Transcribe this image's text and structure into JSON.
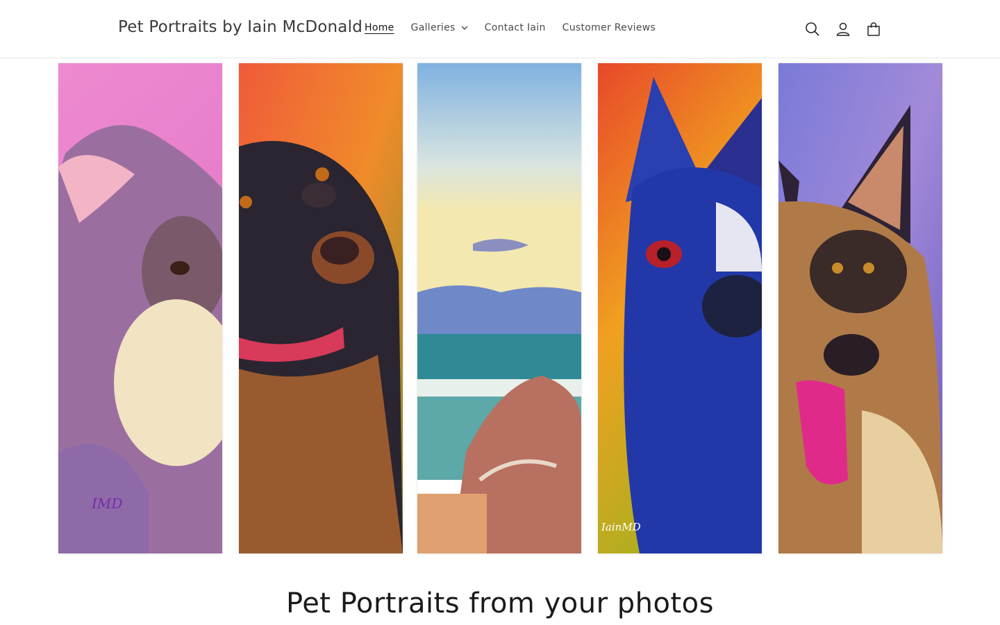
{
  "header": {
    "brand": "Pet Portraits by Iain McDonald",
    "nav": [
      {
        "label": "Home",
        "active": true
      },
      {
        "label": "Galleries",
        "has_dropdown": true
      },
      {
        "label": "Contact Iain"
      },
      {
        "label": "Customer Reviews"
      }
    ],
    "icons": [
      "search-icon",
      "account-icon",
      "cart-icon"
    ]
  },
  "hero": {
    "panels": [
      "terrier-portrait",
      "black-and-tan-dog-portrait",
      "seascape-rocks-painting",
      "boston-terrier-portrait",
      "german-shepherd-portrait"
    ],
    "signatures": [
      "IMD",
      "IainMD"
    ]
  },
  "headline": "Pet Portraits from your photos",
  "colors": {
    "text": "#121212",
    "muted": "#4a4a4a",
    "border": "#e6e6e6"
  }
}
